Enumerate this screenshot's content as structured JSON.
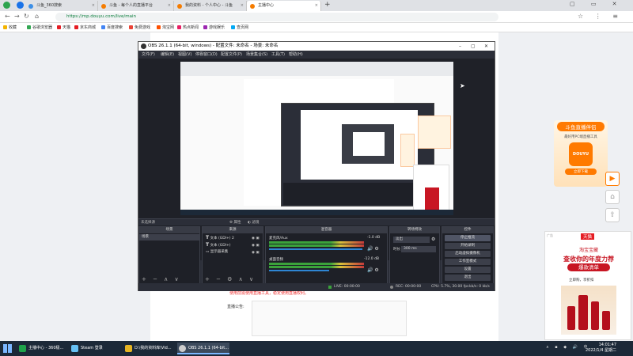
{
  "browser": {
    "tabs": [
      {
        "label": "斗鱼_360搜索",
        "active": false
      },
      {
        "label": "斗鱼 - 每个人的直播平台",
        "active": false
      },
      {
        "label": "我的资料 - 个人中心 - 斗鱼",
        "active": false
      },
      {
        "label": "主播中心",
        "active": true
      }
    ],
    "url": "https://mp.douyu.com/live/main",
    "bookmarks": [
      "收藏",
      "谷歌浏览器",
      "天猫",
      "京东商城",
      "百度搜索",
      "免费游戏",
      "淘宝网",
      "热点新闻",
      "游戏娱乐",
      "查页网"
    ]
  },
  "page": {
    "notice": "使用前需使用直播工具，稳定使用直播权利。",
    "announcement_label": "直播公告:"
  },
  "promo": {
    "title": "斗鱼直播伴侣",
    "subtitle": "最好用PC端直播工具",
    "logo": "DOUYU",
    "button": "立即下载"
  },
  "ad": {
    "tag": "广告",
    "brand": "天猫",
    "line1": "淘宝宝藏",
    "line2": "查收你的年度力荐",
    "line3": "爆款清单",
    "cta": "立即购，享折扣"
  },
  "obs": {
    "title": "OBS 26.1.1 (64-bit, windows) - 配置文件: 未命名 - 场景: 未命名",
    "menu": [
      "文件(F)",
      "编辑(E)",
      "视图(V)",
      "停靠窗口(D)",
      "配置文件(P)",
      "场景集合(S)",
      "工具(T)",
      "帮助(H)"
    ],
    "source_bar": "未选择源",
    "source_bar_buttons": [
      "属性",
      "滤镜"
    ],
    "docks": {
      "scenes": {
        "header": "场景",
        "items": [
          "场景"
        ]
      },
      "sources": {
        "header": "来源",
        "items": [
          "文本 (GDI+) 2",
          "文本 (GDI+)",
          "显示器采集"
        ]
      },
      "mixer": {
        "header": "混音器",
        "channels": [
          {
            "name": "麦克风/Aux",
            "db": "-1.0 dB"
          },
          {
            "name": "桌面音频",
            "db": "-12.0 dB"
          }
        ]
      },
      "transitions": {
        "header": "转场特效",
        "type": "淡出",
        "duration_label": "时长",
        "duration": "300 ms"
      },
      "controls": {
        "header": "控件",
        "buttons": [
          "停止推流",
          "开始录制",
          "启动虚拟摄像机",
          "工作室模式",
          "设置",
          "退出"
        ]
      }
    },
    "status": {
      "live": "LIVE: 00:00:00",
      "rec": "REC: 00:00:00",
      "cpu": "CPU: 5.7%, 30.00 fps",
      "kbps": "kb/s: 0 kb/s"
    }
  },
  "taskbar": {
    "tasks": [
      {
        "label": "主播中心 - 360极...",
        "active": false,
        "color": "#1fa34a"
      },
      {
        "label": "Steam 登录",
        "active": false,
        "color": "#1b2838"
      },
      {
        "label": "D:\\我的资料库\\Vid...",
        "active": false,
        "color": "#e6b422"
      },
      {
        "label": "OBS 26.1.1 (64-bit...",
        "active": true,
        "color": "#333333"
      }
    ],
    "time": "14:01:47",
    "date": "2022/1/4 星期二"
  },
  "colors": {
    "obs_bg": "#2b2e38",
    "brand_orange": "#ff7a00",
    "tmall_red": "#e51d23"
  }
}
